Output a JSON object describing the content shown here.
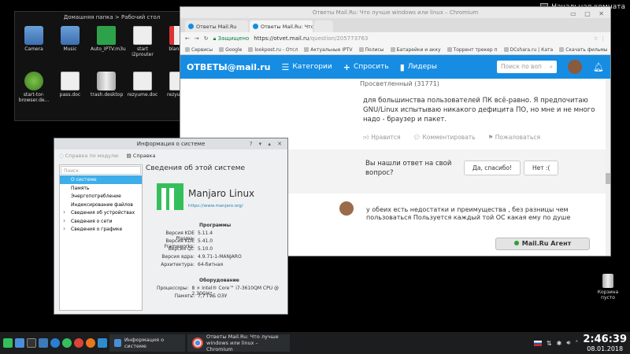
{
  "desktop": {
    "room_label": "Начальная комната",
    "trash_label": "Корзина\nпусто"
  },
  "folder_window": {
    "title": "Домашняя папка > Рабочий стол",
    "icons": [
      {
        "label": "Camera",
        "kind": "folder"
      },
      {
        "label": "Music",
        "kind": "folder"
      },
      {
        "label": "Auto_IPTV.m3u",
        "kind": "music"
      },
      {
        "label": "start i2prouter",
        "kind": "file"
      },
      {
        "label": "blanks.b",
        "kind": "pdf"
      },
      {
        "label": "start-tor-browser.de...",
        "kind": "green"
      },
      {
        "label": "pass.doc",
        "kind": "file"
      },
      {
        "label": "trash.desktop",
        "kind": "can"
      },
      {
        "label": "rezyume.doc",
        "kind": "file"
      },
      {
        "label": "rezyume2",
        "kind": "file"
      }
    ]
  },
  "chrome": {
    "window_title": "Ответы Mail.Ru: Что лучше windows или linux – Chromium",
    "tabs": [
      {
        "label": "Ответы Mail.Ru",
        "active": false
      },
      {
        "label": "Ответы Mail.Ru: Что л",
        "active": true
      },
      {
        "label": "",
        "active": false
      }
    ],
    "secure_label": "Защищено",
    "url_host": "https://otvet.mail.ru",
    "url_path": "/question/205773763",
    "bookmarks": [
      "Сервисы",
      "Google",
      "lookpost.ru - Отсл",
      "Актуальные IPTV",
      "Полисы",
      "Батарейки и акку",
      "Торрент трекер п",
      "DCshara.ru | Ката",
      "Скачать фильмы"
    ],
    "mail_nav": {
      "logo": "ОТВЕТЫ@mail.ru",
      "categories": "Категории",
      "ask": "Спросить",
      "leaders": "Лидеры",
      "search_placeholder": "Поиск по воп"
    },
    "answer": {
      "rank": "Просветленный (31771)",
      "text": "для большинства пользователей ПК всё-равно. Я предпочитаю GNU/Linux испытываю никакого дефицита ПО, но мне и не много надо - браузер и пакет.",
      "like": "Нравится",
      "comment": "Комментировать",
      "report": "Пожаловаться"
    },
    "question_box": {
      "question": "Вы нашли ответ на свой вопрос?",
      "yes": "Да, спасибо!",
      "no": "Нет :("
    },
    "reply": "у обеих есть недостатки и преимущества , без разницы чем пользоваться Пользуется каждый той ОС какая ему по душе",
    "agent_label": "Mail.Ru Агент"
  },
  "sysinfo": {
    "title": "Информация о системе",
    "toolbar_back": "Справка по модулю",
    "toolbar_help": "Справка",
    "search_placeholder": "Поиск",
    "sidebar": [
      {
        "label": "О системе",
        "selected": true,
        "expandable": false
      },
      {
        "label": "Память",
        "selected": false,
        "expandable": false
      },
      {
        "label": "Энергопотребление",
        "selected": false,
        "expandable": false
      },
      {
        "label": "Индексирование файлов",
        "selected": false,
        "expandable": false
      },
      {
        "label": "Сведения об устройствах",
        "selected": false,
        "expandable": true
      },
      {
        "label": "Сведения о сети",
        "selected": false,
        "expandable": true
      },
      {
        "label": "Сведения о графике",
        "selected": false,
        "expandable": true
      }
    ],
    "heading": "Сведения об этой системе",
    "os_name": "Manjaro Linux",
    "os_url": "https://www.manjaro.org/",
    "programs_header": "Программы",
    "programs": [
      {
        "k": "Версия KDE Plasma:",
        "v": "5.11.4"
      },
      {
        "k": "Версия KDE Frameworks:",
        "v": "5.41.0"
      },
      {
        "k": "Версия Qt:",
        "v": "5.10.0"
      },
      {
        "k": "Версия ядра:",
        "v": "4.9.71-1-MANJARO"
      },
      {
        "k": "Архитектура:",
        "v": "64-битная"
      }
    ],
    "hardware_header": "Оборудование",
    "hardware": [
      {
        "k": "Процессоры:",
        "v": "8 × Intel® Core™ i7-3610QM CPU @ 2.30GHz"
      },
      {
        "k": "Память:",
        "v": "7,7 ГиБ ОЗУ"
      }
    ]
  },
  "taskbar": {
    "task_sysinfo": "Информация о системе",
    "task_chromium": "Ответы Mail.Ru: Что лучше windows или linux – Chromium",
    "time": "2:46:39",
    "date": "08.01.2018"
  }
}
